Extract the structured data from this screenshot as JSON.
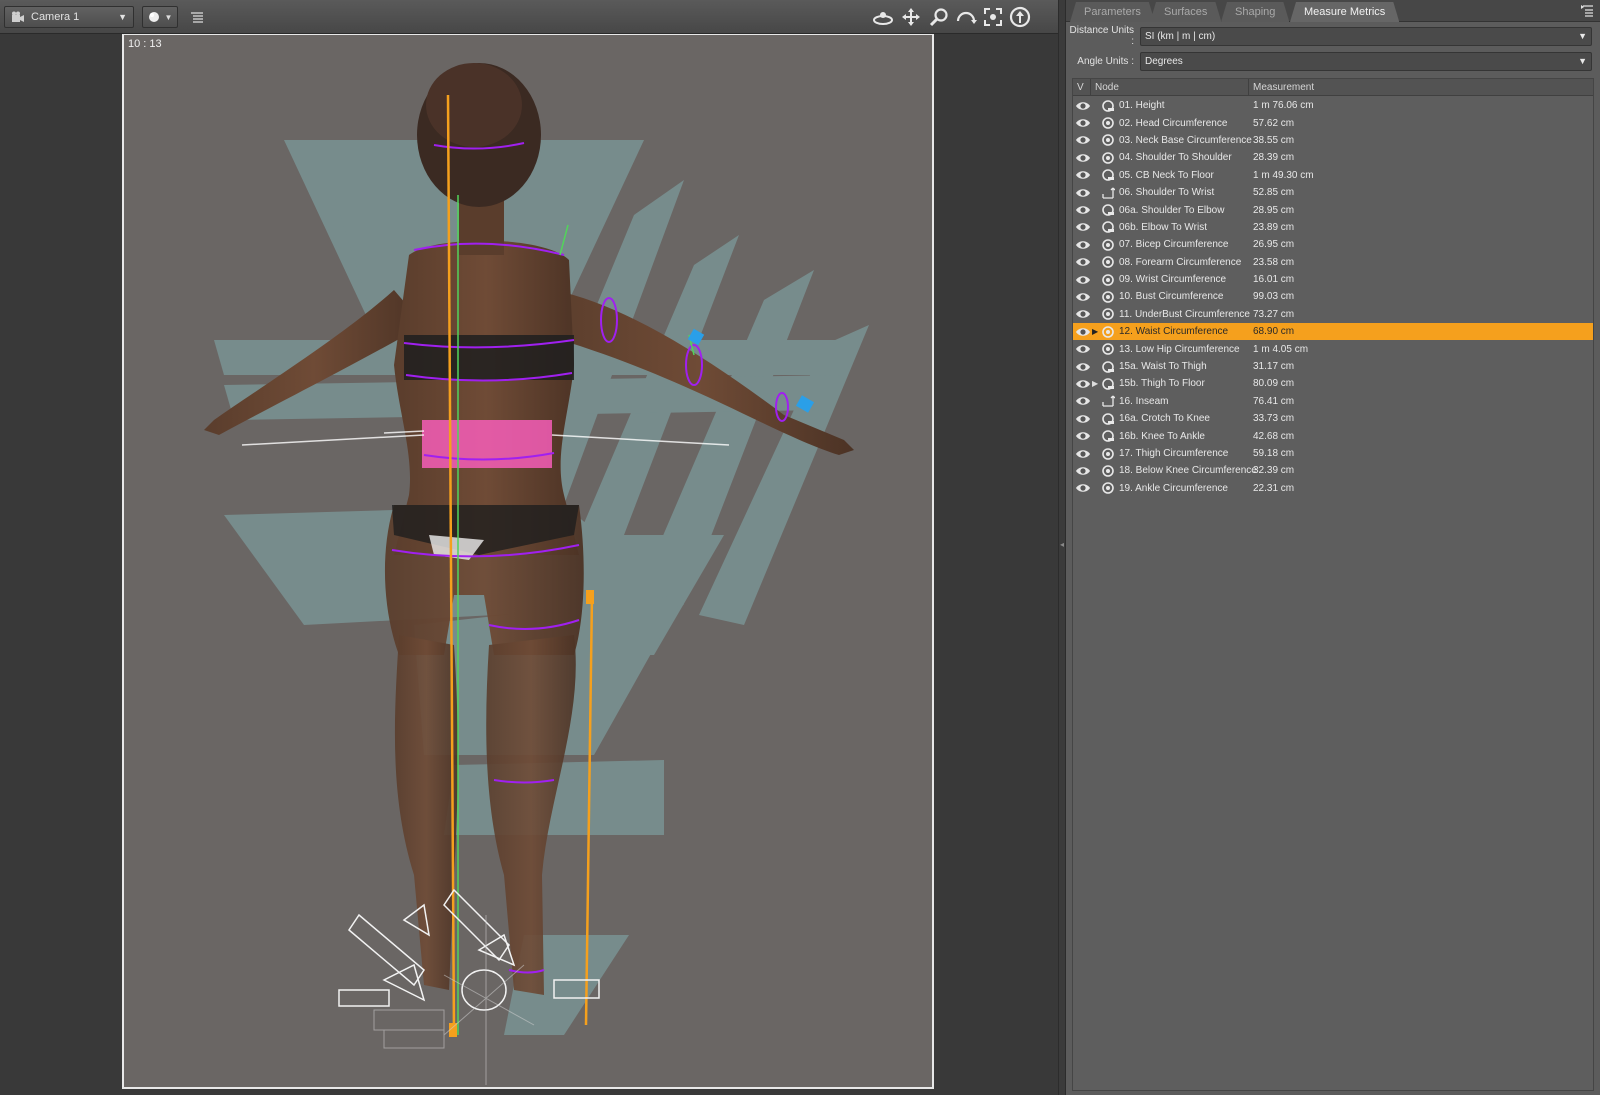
{
  "viewport": {
    "camera_label": "Camera 1",
    "aspect_ratio": "10 : 13"
  },
  "panel": {
    "tabs": [
      {
        "label": "Parameters",
        "active": false
      },
      {
        "label": "Surfaces",
        "active": false
      },
      {
        "label": "Shaping",
        "active": false
      },
      {
        "label": "Measure Metrics",
        "active": true
      }
    ],
    "distance_units_label": "Distance Units :",
    "distance_units_value": "SI (km | m | cm)",
    "angle_units_label": "Angle Units :",
    "angle_units_value": "Degrees",
    "columns": {
      "v": "V",
      "node": "Node",
      "measurement": "Measurement"
    },
    "rows": [
      {
        "name": "01. Height",
        "value": "1 m 76.06 cm",
        "icon": "tape-icon",
        "expandable": false,
        "selected": false
      },
      {
        "name": "02. Head Circumference",
        "value": "57.62 cm",
        "icon": "loop-icon",
        "expandable": false,
        "selected": false
      },
      {
        "name": "03. Neck Base Circumference",
        "value": "38.55 cm",
        "icon": "loop-icon",
        "expandable": false,
        "selected": false
      },
      {
        "name": "04. Shoulder To Shoulder",
        "value": "28.39 cm",
        "icon": "loop-icon",
        "expandable": false,
        "selected": false
      },
      {
        "name": "05. CB Neck To Floor",
        "value": "1 m 49.30 cm",
        "icon": "tape-icon",
        "expandable": false,
        "selected": false
      },
      {
        "name": "06. Shoulder To Wrist",
        "value": "52.85 cm",
        "icon": "ruler-icon",
        "expandable": false,
        "selected": false
      },
      {
        "name": "06a. Shoulder To Elbow",
        "value": "28.95 cm",
        "icon": "tape-icon",
        "expandable": false,
        "selected": false
      },
      {
        "name": "06b. Elbow To Wrist",
        "value": "23.89 cm",
        "icon": "tape-icon",
        "expandable": false,
        "selected": false
      },
      {
        "name": "07. Bicep Circumference",
        "value": "26.95 cm",
        "icon": "loop-icon",
        "expandable": false,
        "selected": false
      },
      {
        "name": "08. Forearm Circumference",
        "value": "23.58 cm",
        "icon": "loop-icon",
        "expandable": false,
        "selected": false
      },
      {
        "name": "09. Wrist Circumference",
        "value": "16.01 cm",
        "icon": "loop-icon",
        "expandable": false,
        "selected": false
      },
      {
        "name": "10. Bust Circumference",
        "value": "99.03 cm",
        "icon": "loop-icon",
        "expandable": false,
        "selected": false
      },
      {
        "name": "11. UnderBust Circumference",
        "value": "73.27 cm",
        "icon": "loop-icon",
        "expandable": false,
        "selected": false
      },
      {
        "name": "12. Waist Circumference",
        "value": "68.90 cm",
        "icon": "loop-icon",
        "expandable": true,
        "selected": true
      },
      {
        "name": "13. Low Hip Circumference",
        "value": "1 m 4.05 cm",
        "icon": "loop-icon",
        "expandable": false,
        "selected": false
      },
      {
        "name": "15a. Waist To Thigh",
        "value": "31.17 cm",
        "icon": "tape-icon",
        "expandable": false,
        "selected": false
      },
      {
        "name": "15b. Thigh To Floor",
        "value": "80.09 cm",
        "icon": "tape-icon",
        "expandable": true,
        "selected": false
      },
      {
        "name": "16. Inseam",
        "value": "76.41 cm",
        "icon": "ruler-icon",
        "expandable": false,
        "selected": false
      },
      {
        "name": "16a. Crotch To Knee",
        "value": "33.73 cm",
        "icon": "tape-icon",
        "expandable": false,
        "selected": false
      },
      {
        "name": "16b. Knee To Ankle",
        "value": "42.68 cm",
        "icon": "tape-icon",
        "expandable": false,
        "selected": false
      },
      {
        "name": "17. Thigh Circumference",
        "value": "59.18 cm",
        "icon": "loop-icon",
        "expandable": false,
        "selected": false
      },
      {
        "name": "18. Below Knee Circumference",
        "value": "32.39 cm",
        "icon": "loop-icon",
        "expandable": false,
        "selected": false
      },
      {
        "name": "19. Ankle Circumference",
        "value": "22.31 cm",
        "icon": "loop-icon",
        "expandable": false,
        "selected": false
      }
    ]
  },
  "colors": {
    "selection": "#f5a01d",
    "measure_loop": "#a020f0",
    "measure_guide": "#f5a01d",
    "plane": "#8fd4d8",
    "waist_highlight": "#ff5fc0"
  }
}
